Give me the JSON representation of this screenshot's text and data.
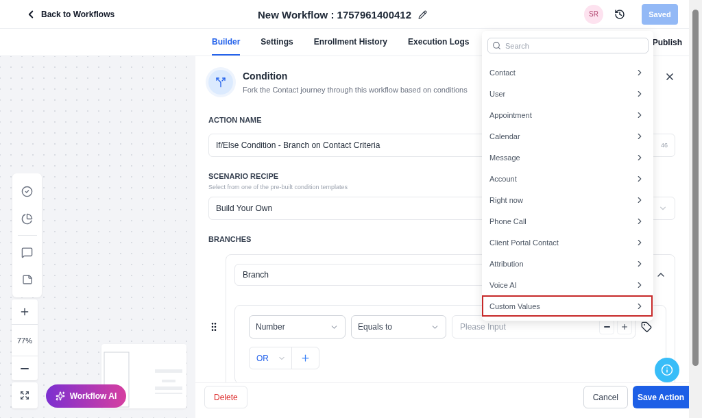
{
  "top_bar": {
    "back_link": "Back to Workflows",
    "title": "New Workflow : 1757961400412",
    "avatar": "SR",
    "save_button": "Saved"
  },
  "tabs": [
    {
      "label": "Builder",
      "selected": true
    },
    {
      "label": "Settings",
      "selected": false
    },
    {
      "label": "Enrollment History",
      "selected": false
    },
    {
      "label": "Execution Logs",
      "selected": false
    }
  ],
  "publish_label": "Publish",
  "canvas": {
    "zoom": "77%",
    "ai_button": "Workflow AI"
  },
  "panel": {
    "title": "Condition",
    "subtitle": "Fork the Contact journey through this workflow based on conditions",
    "action_name": {
      "label": "ACTION NAME",
      "value": "If/Else Condition - Branch on Contact Criteria",
      "count": "46"
    },
    "scenario": {
      "label": "SCENARIO RECIPE",
      "hint": "Select from one of the pre-built condition templates",
      "value": "Build Your Own"
    },
    "branches": {
      "label": "BRANCHES",
      "branch_name": "Branch",
      "field": "Number",
      "operator": "Equals to",
      "value_placeholder": "Please Input",
      "joiner": "OR"
    }
  },
  "footer": {
    "delete": "Delete",
    "cancel": "Cancel",
    "save": "Save Action"
  },
  "menu": {
    "search_placeholder": "Search",
    "items": [
      {
        "label": "Contact",
        "selected": false
      },
      {
        "label": "User",
        "selected": false
      },
      {
        "label": "Appointment",
        "selected": false
      },
      {
        "label": "Calendar",
        "selected": false
      },
      {
        "label": "Message",
        "selected": false
      },
      {
        "label": "Account",
        "selected": false
      },
      {
        "label": "Right now",
        "selected": false
      },
      {
        "label": "Phone Call",
        "selected": false
      },
      {
        "label": "Client Portal Contact",
        "selected": false
      },
      {
        "label": "Attribution",
        "selected": false
      },
      {
        "label": "Voice AI",
        "selected": false
      },
      {
        "label": "Custom Values",
        "selected": true
      }
    ]
  }
}
